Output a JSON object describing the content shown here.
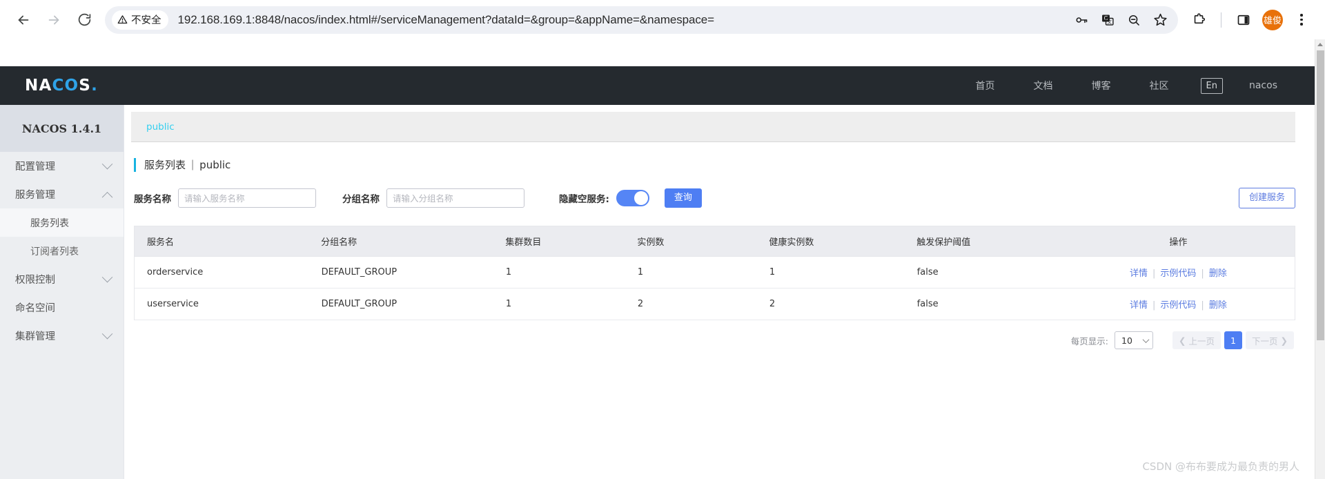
{
  "browser": {
    "back_icon": "back-arrow-icon",
    "forward_icon": "forward-arrow-icon",
    "reload_icon": "reload-icon",
    "security_label": "不安全",
    "url": "192.168.169.1:8848/nacos/index.html#/serviceManagement?dataId=&group=&appName=&namespace=",
    "omnibox_icons": [
      "password-key-icon",
      "translate-icon",
      "zoom-out-icon",
      "bookmark-star-icon"
    ],
    "toolbar_icons": [
      "extensions-puzzle-icon",
      "side-panel-icon"
    ],
    "avatar_label": "雄俊",
    "menu_icon": "three-dot-menu-icon"
  },
  "header": {
    "logo": {
      "part1": "NA",
      "part2": "CO",
      "part3": "S",
      "dot": "."
    },
    "nav": [
      {
        "label": "首页"
      },
      {
        "label": "文档"
      },
      {
        "label": "博客"
      },
      {
        "label": "社区"
      }
    ],
    "language": "En",
    "user": "nacos"
  },
  "sidebar": {
    "version_title": "NACOS 1.4.1",
    "items": [
      {
        "label": "配置管理",
        "expandable": true,
        "expanded": false,
        "active": false,
        "sub": false
      },
      {
        "label": "服务管理",
        "expandable": true,
        "expanded": true,
        "active": false,
        "sub": false
      },
      {
        "label": "服务列表",
        "expandable": false,
        "expanded": false,
        "active": true,
        "sub": true
      },
      {
        "label": "订阅者列表",
        "expandable": false,
        "expanded": false,
        "active": false,
        "sub": true
      },
      {
        "label": "权限控制",
        "expandable": true,
        "expanded": false,
        "active": false,
        "sub": false
      },
      {
        "label": "命名空间",
        "expandable": false,
        "expanded": false,
        "active": false,
        "sub": false
      },
      {
        "label": "集群管理",
        "expandable": true,
        "expanded": false,
        "active": false,
        "sub": false
      }
    ]
  },
  "main": {
    "namespace_tab": "public",
    "page_title": "服务列表",
    "page_title_separator": "|",
    "page_namespace": "public",
    "filters": {
      "service_name_label": "服务名称",
      "service_name_placeholder": "请输入服务名称",
      "service_name_value": "",
      "group_name_label": "分组名称",
      "group_name_placeholder": "请输入分组名称",
      "group_name_value": "",
      "hide_empty_label": "隐藏空服务:",
      "hide_empty_on": true,
      "search_button": "查询",
      "create_button": "创建服务"
    },
    "table": {
      "columns": [
        "服务名",
        "分组名称",
        "集群数目",
        "实例数",
        "健康实例数",
        "触发保护阈值",
        "操作"
      ],
      "rows": [
        {
          "service_name": "orderservice",
          "group_name": "DEFAULT_GROUP",
          "cluster_count": "1",
          "instance_count": "1",
          "healthy_instance_count": "1",
          "protect_threshold": "false",
          "actions": [
            "详情",
            "示例代码",
            "删除"
          ]
        },
        {
          "service_name": "userservice",
          "group_name": "DEFAULT_GROUP",
          "cluster_count": "1",
          "instance_count": "2",
          "healthy_instance_count": "2",
          "protect_threshold": "false",
          "actions": [
            "详情",
            "示例代码",
            "删除"
          ]
        }
      ]
    },
    "pagination": {
      "page_size_label": "每页显示:",
      "page_size_value": "10",
      "prev_label": "上一页",
      "next_label": "下一页",
      "current_page": "1"
    }
  },
  "watermark": "CSDN @布布要成为最负责的男人",
  "colors": {
    "accent_blue": "#4e7ef3",
    "link_blue": "#5b7ce0",
    "tab_cyan": "#33cfef",
    "header_dark": "#252a2f",
    "avatar_orange": "#e8710a"
  }
}
